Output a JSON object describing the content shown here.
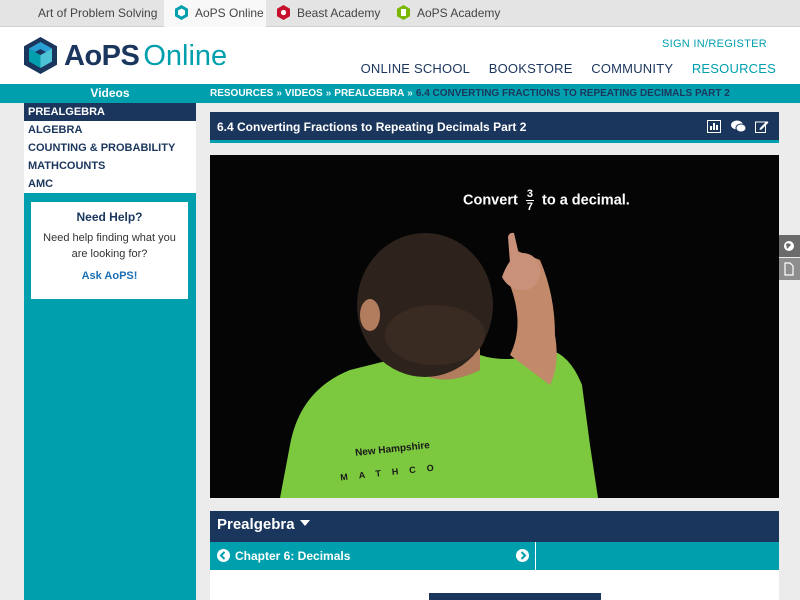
{
  "topbar": {
    "sites": [
      {
        "label": "Art of Problem Solving"
      },
      {
        "label": "AoPS Online",
        "active": true
      },
      {
        "label": "Beast Academy"
      },
      {
        "label": "AoPS Academy"
      }
    ]
  },
  "header": {
    "logo_main": "AoPS",
    "logo_sub": "Online",
    "signin": "SIGN IN/REGISTER",
    "nav": [
      "ONLINE SCHOOL",
      "BOOKSTORE",
      "COMMUNITY",
      "RESOURCES"
    ]
  },
  "breadcrumb": {
    "items": [
      "RESOURCES",
      "VIDEOS",
      "PREALGEBRA"
    ],
    "separator": "»",
    "current": "6.4 CONVERTING FRACTIONS TO REPEATING DECIMALS PART 2"
  },
  "sidebar": {
    "title": "Videos",
    "items": [
      "PREALGEBRA",
      "ALGEBRA",
      "COUNTING & PROBABILITY",
      "MATHCOUNTS",
      "AMC"
    ],
    "help": {
      "heading": "Need Help?",
      "text": "Need help finding what you are looking for?",
      "link": "Ask AoPS!"
    }
  },
  "video": {
    "title": "6.4 Converting Fractions to Repeating Decimals Part 2",
    "overlay_prefix": "Convert",
    "numerator": "3",
    "denominator": "7",
    "overlay_suffix": "to a decimal.",
    "shirt_line1": "New Hampshire",
    "shirt_line2": "MATHCO"
  },
  "course": {
    "title": "Prealgebra",
    "chapter": "Chapter 6: Decimals"
  },
  "colors": {
    "navy": "#1b365d",
    "teal": "#009fad",
    "shirt": "#7cc83e"
  }
}
